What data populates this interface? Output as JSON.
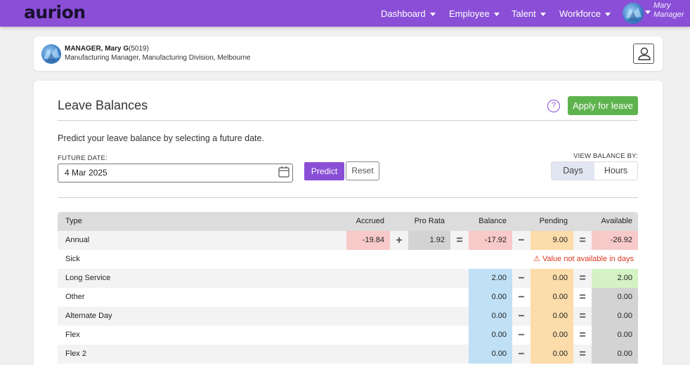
{
  "app": {
    "logo": "aurion"
  },
  "nav": [
    {
      "label": "Dashboard"
    },
    {
      "label": "Employee"
    },
    {
      "label": "Talent"
    },
    {
      "label": "Workforce"
    }
  ],
  "user": {
    "first": "Mary",
    "last": "Manager"
  },
  "profile": {
    "name": "MANAGER, Mary G",
    "id": "(5019)",
    "role": "Manufacturing Manager, Manufacturing Division, Melbourne"
  },
  "page": {
    "title": "Leave Balances",
    "help": "?",
    "apply_label": "Apply for leave",
    "subtitle": "Predict your leave balance by selecting a future date."
  },
  "form": {
    "future_label": "FUTURE DATE:",
    "future_value": "4 Mar 2025",
    "predict_label": "Predict",
    "reset_label": "Reset",
    "view_label": "VIEW BALANCE BY:",
    "options": [
      "Days",
      "Hours"
    ],
    "selected": "Days"
  },
  "colors": {
    "accent": "#8a4fd6",
    "apply_green": "#5fb34f",
    "negative": "#f8c9c9",
    "pending": "#fbdcaa",
    "balance_blue": "#bfe0f5",
    "available_green": "#d4f2c4",
    "neutral_grey": "#d3d3d3",
    "warning": "#d9381e"
  },
  "table": {
    "headers": {
      "type": "Type",
      "accrued": "Accrued",
      "prorata": "Pro Rata",
      "balance": "Balance",
      "pending": "Pending",
      "available": "Available"
    },
    "ops": {
      "plus": "+",
      "eq": "=",
      "minus": "−"
    },
    "warning": "⚠ Value not available in days",
    "rows": [
      {
        "type": "Annual",
        "accrued": "-19.84",
        "prorata": "1.92",
        "balance": "-17.92",
        "pending": "9.00",
        "available": "-26.92"
      },
      {
        "type": "Sick",
        "warning": true
      },
      {
        "type": "Long Service",
        "balance": "2.00",
        "pending": "0.00",
        "available": "2.00"
      },
      {
        "type": "Other",
        "balance": "0.00",
        "pending": "0.00",
        "available": "0.00"
      },
      {
        "type": "Alternate Day",
        "balance": "0.00",
        "pending": "0.00",
        "available": "0.00"
      },
      {
        "type": "Flex",
        "balance": "0.00",
        "pending": "0.00",
        "available": "0.00"
      },
      {
        "type": "Flex 2",
        "balance": "0.00",
        "pending": "0.00",
        "available": "0.00"
      }
    ]
  }
}
